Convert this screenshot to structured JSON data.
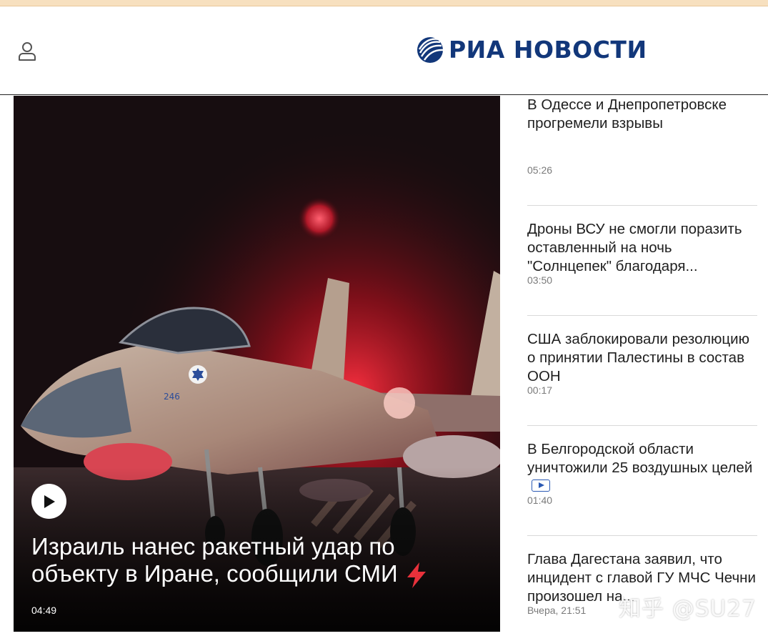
{
  "header": {
    "logo_text": "РИА НОВОСТИ",
    "user_icon": "user-icon",
    "brand_color": "#12377a"
  },
  "hero": {
    "title": "Израиль нанес ракетный удар по объекту в Иране, сообщили СМИ",
    "time": "04:49",
    "play_icon": "play-icon",
    "lightning_icon": "lightning-icon",
    "tail_number": "246"
  },
  "news": [
    {
      "title": "В Одессе и Днепропетровске прогремели взрывы",
      "time": "05:26"
    },
    {
      "title": "Дроны ВСУ не смогли поразить оставленный на ночь \"Солнцепек\" благодаря...",
      "time": "03:50"
    },
    {
      "title": "США заблокировали резолюцию о принятии Палестины в состав ООН",
      "time": "00:17"
    },
    {
      "title": "В Белгородской области уничтожили 25 воздушных целей",
      "time": "01:40",
      "video_icon": "video-icon"
    },
    {
      "title": "Глава Дагестана заявил, что инцидент с главой ГУ МЧС Чечни произошел на...",
      "time": "Вчера, 21:51"
    }
  ],
  "watermark": "知乎 @SU27",
  "colors": {
    "accent_red": "#e8313b",
    "video_blue": "#2a59b3",
    "top_strip": "#f7e0bf"
  }
}
